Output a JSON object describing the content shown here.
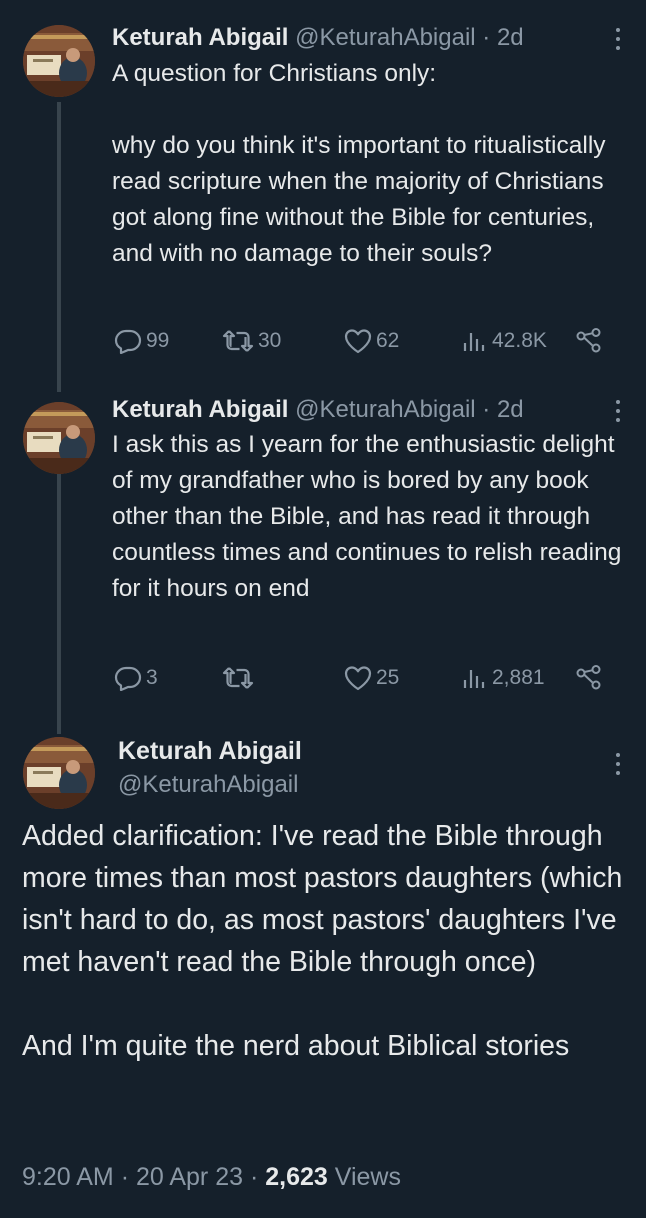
{
  "tweets": [
    {
      "name": "Keturah Abigail",
      "handle": "@KeturahAbigail",
      "time": "· 2d",
      "text": "A question for Christians only:\n\nwhy do you think it's important to ritualistically read scripture when the majority of Christians got along fine without the Bible for centuries, and with no damage to their souls?",
      "replies": "99",
      "retweets": "30",
      "likes": "62",
      "views": "42.8K"
    },
    {
      "name": "Keturah Abigail",
      "handle": "@KeturahAbigail",
      "time": "· 2d",
      "text": "I ask this as I yearn for the enthusiastic delight of my grandfather who is bored by any book other than the Bible, and has read it through countless times and continues to relish reading for it hours on end",
      "replies": "3",
      "retweets": "",
      "likes": "25",
      "views": "2,881"
    }
  ],
  "main_tweet": {
    "name": "Keturah Abigail",
    "handle": "@KeturahAbigail",
    "text": "Added clarification: I've read the Bible through more times than most pastors daughters (which isn't hard to do, as most pastors' daughters I've met haven't read the Bible through once)\n\nAnd I'm quite the nerd about Biblical stories",
    "time": "9:20 AM",
    "date": "20 Apr 23",
    "views_count": "2,623",
    "views_label": "Views"
  },
  "icons": [
    "reply-icon",
    "retweet-icon",
    "like-icon",
    "views-icon",
    "share-icon",
    "more-icon"
  ],
  "colors": {
    "background": "#15202b",
    "text": "#e7e9ea",
    "muted": "#8b98a5",
    "thread_line": "#38444d"
  }
}
